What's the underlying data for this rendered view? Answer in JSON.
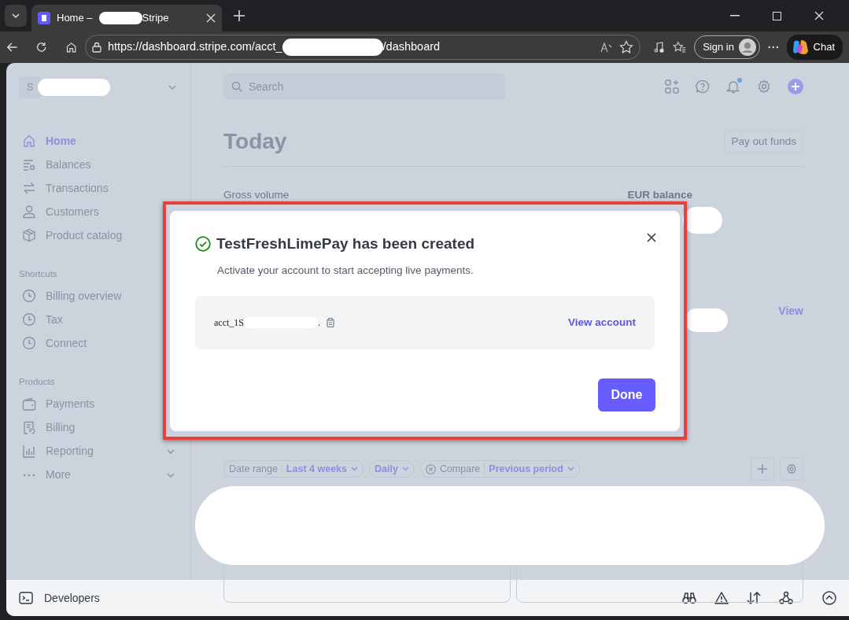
{
  "browser": {
    "tab_title_start": "Home –",
    "tab_title_end": "Stripe",
    "url_start": "https://dashboard.stripe.com/acct_",
    "url_end": "/dashboard",
    "sign_in": "Sign in",
    "chat": "Chat"
  },
  "sidebar": {
    "account_initial": "S",
    "items": [
      {
        "label": "Home",
        "selected": true
      },
      {
        "label": "Balances",
        "selected": false
      },
      {
        "label": "Transactions",
        "selected": false
      },
      {
        "label": "Customers",
        "selected": false
      },
      {
        "label": "Product catalog",
        "selected": false
      }
    ],
    "sections": [
      {
        "title": "Shortcuts",
        "items": [
          {
            "label": "Billing overview",
            "expandable": false
          },
          {
            "label": "Tax",
            "expandable": false
          },
          {
            "label": "Connect",
            "expandable": false
          }
        ]
      },
      {
        "title": "Products",
        "items": [
          {
            "label": "Payments",
            "expandable": false
          },
          {
            "label": "Billing",
            "expandable": false
          },
          {
            "label": "Reporting",
            "expandable": true
          },
          {
            "label": "More",
            "expandable": true
          }
        ]
      }
    ]
  },
  "header": {
    "search_placeholder": "Search",
    "notification": true
  },
  "page": {
    "title": "Today",
    "payout_button": "Pay out funds",
    "gross_volume": "Gross volume",
    "balance_label": "EUR balance",
    "view_link": "View",
    "filters": [
      {
        "label": "Date range",
        "value": "Last 4 weeks",
        "removable": false
      },
      {
        "value": "Daily",
        "removable": false
      },
      {
        "label": "Compare",
        "value": "Previous period",
        "removable": true
      }
    ]
  },
  "footer": {
    "developers": "Developers"
  },
  "modal": {
    "title": "TestFreshLimePay has been created",
    "subtitle": "Activate your account to start accepting live payments.",
    "account_id_start": "acct_1S",
    "account_id_end": ".",
    "view_account": "View account",
    "done": "Done"
  }
}
